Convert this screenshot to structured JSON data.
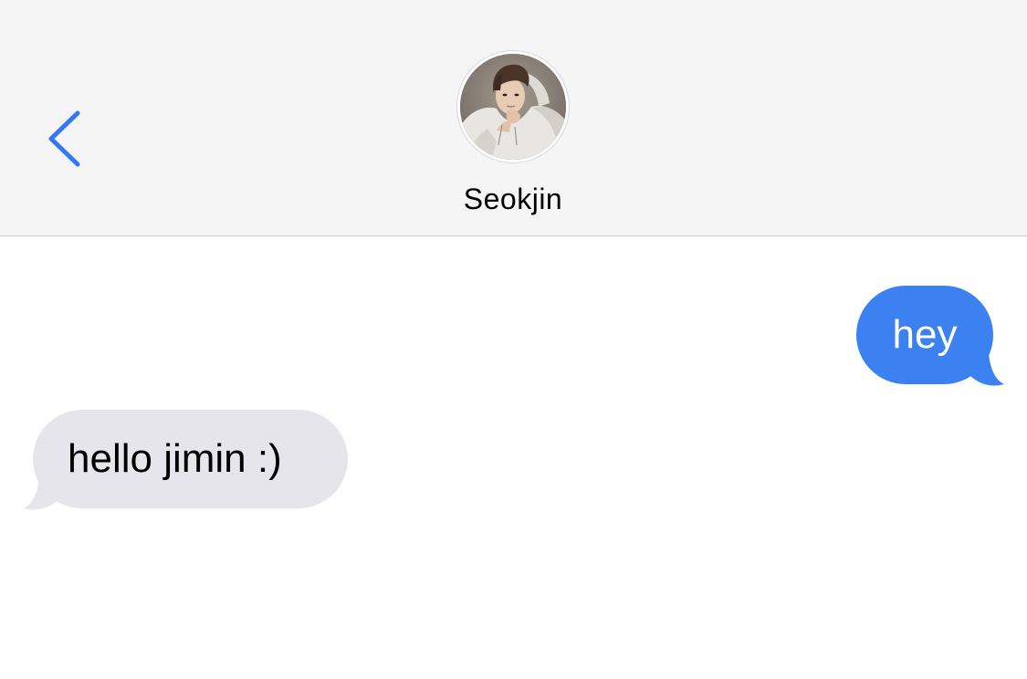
{
  "header": {
    "back_icon": "chevron-left-icon",
    "contact_name": "Seokjin",
    "accent_color": "#3478f6"
  },
  "messages": [
    {
      "direction": "outgoing",
      "text": "hey",
      "color": "#3b82f0"
    },
    {
      "direction": "incoming",
      "text": "hello jimin :)",
      "color": "#e6e5eb"
    }
  ]
}
